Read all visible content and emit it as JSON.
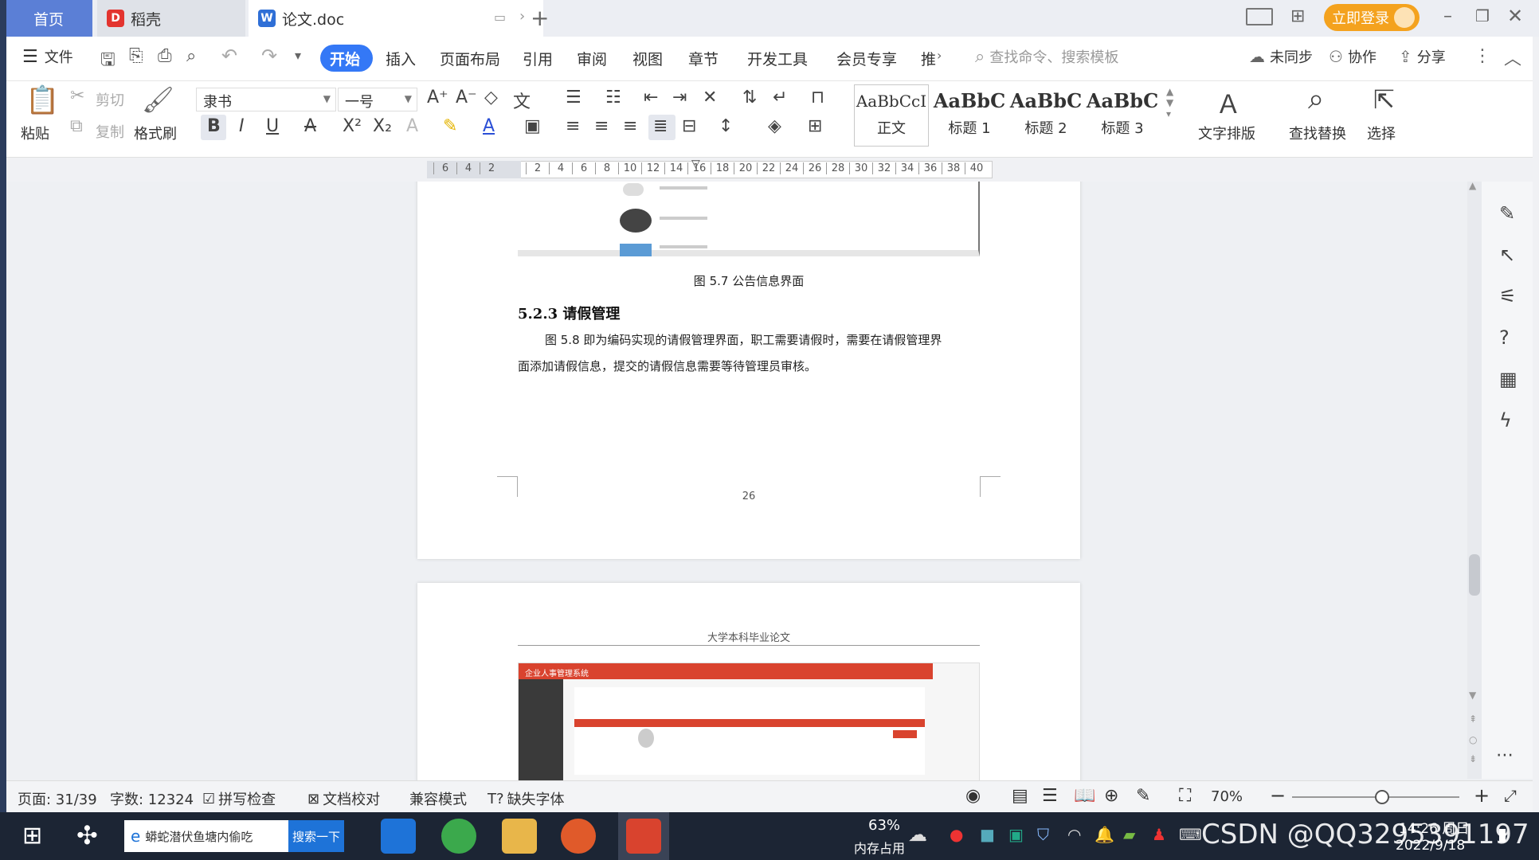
{
  "tabs": {
    "home": "首页",
    "daoke": "稻壳",
    "doc": "论文.doc",
    "add": "+"
  },
  "titlebar": {
    "login_button": "立即登录"
  },
  "menubar": {
    "file": "文件",
    "items": [
      "开始",
      "插入",
      "页面布局",
      "引用",
      "审阅",
      "视图",
      "章节",
      "开发工具",
      "会员专享",
      "推"
    ],
    "search_placeholder": "查找命令、搜索模板",
    "unsync": "未同步",
    "collab": "协作",
    "share": "分享"
  },
  "ribbon": {
    "paste": "粘贴",
    "cut": "剪切",
    "copy": "复制",
    "format_painter": "格式刷",
    "font_name": "隶书",
    "font_size": "一号",
    "styles": [
      {
        "preview": "AaBbCcI",
        "label": "正文"
      },
      {
        "preview": "AaBbC",
        "label": "标题 1"
      },
      {
        "preview": "AaBbC",
        "label": "标题 2"
      },
      {
        "preview": "AaBbC",
        "label": "标题 3"
      }
    ],
    "text_layout": "文字排版",
    "find_replace": "查找替换",
    "select": "选择"
  },
  "ruler": {
    "ticks": [
      "6",
      "4",
      "2",
      "",
      "2",
      "4",
      "6",
      "8",
      "10",
      "12",
      "14",
      "16",
      "18",
      "20",
      "22",
      "24",
      "26",
      "28",
      "30",
      "32",
      "34",
      "36",
      "38",
      "40"
    ]
  },
  "document": {
    "figure_caption": "图 5.7  公告信息界面",
    "section_heading": "5.2.3  请假管理",
    "paragraph_line1": "图 5.8 即为编码实现的请假管理界面，职工需要请假时，需要在请假管理界",
    "paragraph_line2": "面添加请假信息，提交的请假信息需要等待管理员审核。",
    "page_number": "26",
    "next_header": "大学本科毕业论文",
    "embedded_app_title": "企业人事管理系统"
  },
  "statusbar": {
    "page": "页面: 31/39",
    "words": "字数: 12324",
    "spellcheck": "拼写检查",
    "doc_check": "文档校对",
    "compat": "兼容模式",
    "missing_font": "缺失字体",
    "zoom": "70%",
    "zoom_level": 0.7
  },
  "taskbar": {
    "search_text": "蟒蛇潜伏鱼塘内偷吃",
    "search_button": "搜索一下",
    "memory_pct": "63%",
    "memory_label": "内存占用",
    "watermark": "CSDN @QQ3295391197",
    "time": "14:26 周日",
    "date": "2022/9/18"
  },
  "colors": {
    "accent_blue": "#3478f6",
    "login_orange": "#f4a21e",
    "app_red": "#d9432e"
  }
}
